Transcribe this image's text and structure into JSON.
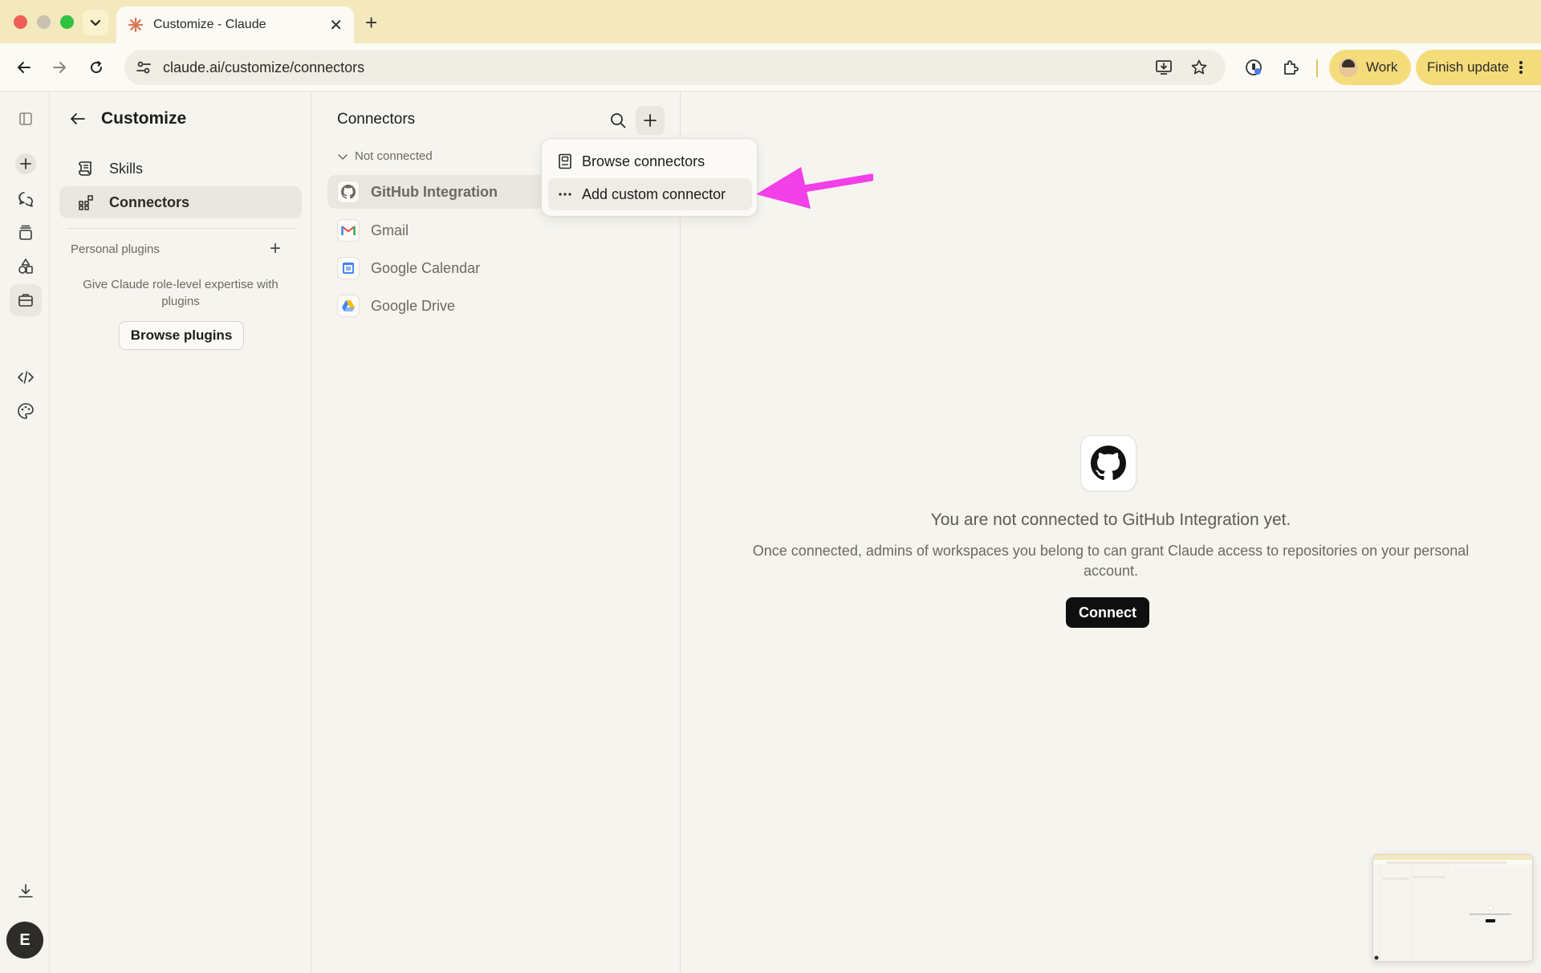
{
  "browser": {
    "tab_title": "Customize - Claude",
    "url": "claude.ai/customize/connectors",
    "profile_label": "Work",
    "update_label": "Finish update"
  },
  "rail": {
    "avatar_initial": "E"
  },
  "customize": {
    "title": "Customize",
    "nav": [
      {
        "label": "Skills"
      },
      {
        "label": "Connectors"
      }
    ],
    "personal_plugins_label": "Personal plugins",
    "plugins_description": "Give Claude role-level expertise with plugins",
    "browse_plugins_label": "Browse plugins"
  },
  "connectors": {
    "title": "Connectors",
    "section_label": "Not connected",
    "items": [
      {
        "label": "GitHub Integration",
        "icon": "github-icon"
      },
      {
        "label": "Gmail",
        "icon": "gmail-icon"
      },
      {
        "label": "Google Calendar",
        "icon": "google-calendar-icon"
      },
      {
        "label": "Google Drive",
        "icon": "google-drive-icon"
      }
    ]
  },
  "menu": {
    "items": [
      {
        "label": "Browse connectors",
        "icon": "book-icon"
      },
      {
        "label": "Add custom connector",
        "icon": "more-icon"
      }
    ]
  },
  "detail": {
    "title": "You are not connected to GitHub Integration yet.",
    "description": "Once connected, admins of workspaces you belong to can grant Claude access to repositories on your personal account.",
    "connect_label": "Connect"
  },
  "colors": {
    "annotation_arrow": "#f33fe8",
    "tab_strip": "#f3e9bd",
    "update_pill": "#f5dc7a"
  }
}
